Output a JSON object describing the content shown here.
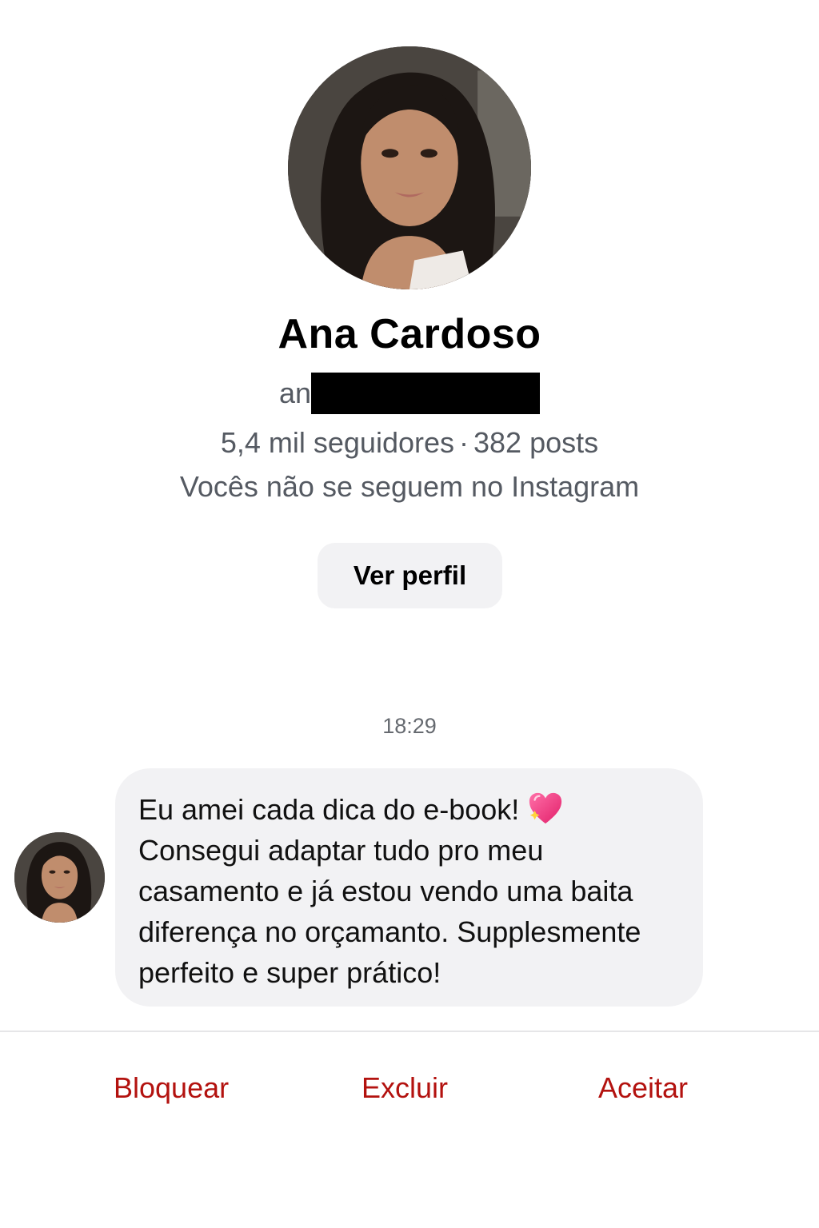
{
  "profile": {
    "name": "Ana Cardoso",
    "username_visible": "an",
    "followers": "5,4 mil seguidores",
    "separator": "·",
    "posts": "382 posts",
    "mutual_status": "Vocês não se seguem no Instagram",
    "view_profile_label": "Ver perfil"
  },
  "thread": {
    "timestamp": "18:29",
    "message": {
      "line1": "Eu amei cada dica do e-book!",
      "rest": "Consegui adaptar tudo pro meu\ncasamento e já estou vendo uma baita\ndiferença no orçamanto. Supplesmente\nperfeito e super prático!",
      "emoji": "sparkling-heart-icon"
    }
  },
  "actions": {
    "block_label": "Bloquear",
    "delete_label": "Excluir",
    "accept_label": "Aceitar"
  },
  "colors": {
    "action_red": "#b3120f",
    "bubble_bg": "#f2f2f4",
    "secondary_text": "#555a62"
  }
}
